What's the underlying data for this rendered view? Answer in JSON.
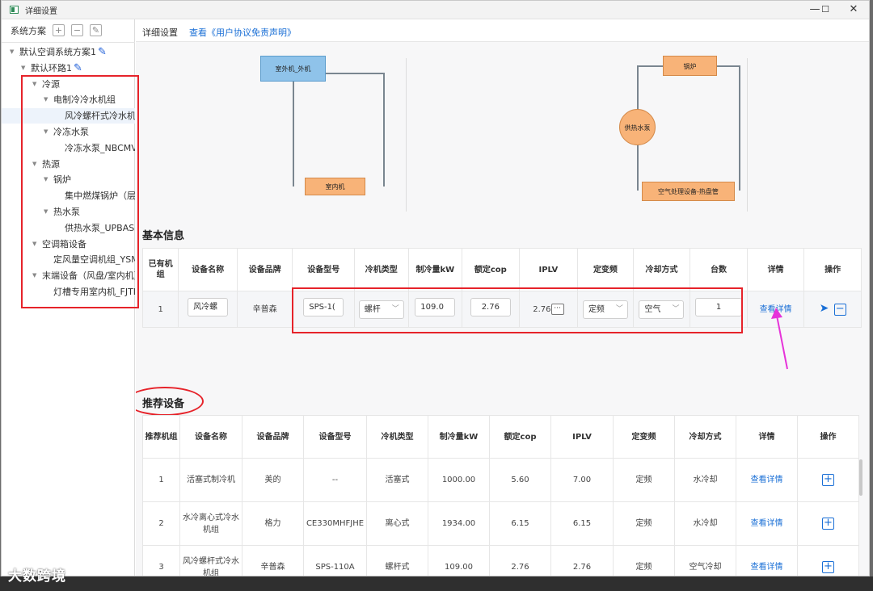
{
  "window": {
    "title": "详细设置",
    "buttons": [
      "—",
      "☐",
      "✕"
    ]
  },
  "sidebar": {
    "header": "系统方案",
    "tools": [
      "+",
      "−",
      "✎"
    ],
    "tree": [
      {
        "label": "默认空调系统方案1",
        "level": 0,
        "caret": true,
        "pencil": true
      },
      {
        "label": "默认环路1",
        "level": 1,
        "caret": true,
        "pencil": true
      },
      {
        "label": "冷源",
        "level": 2,
        "caret": true
      },
      {
        "label": "电制冷冷水机组",
        "level": 3,
        "caret": true
      },
      {
        "label": "风冷螺杆式冷水机组",
        "level": 4,
        "selected": true
      },
      {
        "label": "冷冻水泵",
        "level": 3,
        "caret": true
      },
      {
        "label": "冷冻水泵_NBCMV",
        "level": 4
      },
      {
        "label": "热源",
        "level": 2,
        "caret": true
      },
      {
        "label": "锅炉",
        "level": 3,
        "caret": true
      },
      {
        "label": "集中燃煤锅炉（层",
        "level": 4
      },
      {
        "label": "热水泵",
        "level": 3,
        "caret": true
      },
      {
        "label": "供热水泵_UPBASI",
        "level": 4
      },
      {
        "label": "空调箱设备",
        "level": 2,
        "caret": true
      },
      {
        "label": "定风量空调机组_YSM",
        "level": 3
      },
      {
        "label": "末端设备（风盘/室内机）",
        "level": 2,
        "caret": true
      },
      {
        "label": "灯槽专用室内机_FJTI",
        "level": 3
      }
    ]
  },
  "topbar": {
    "title": "详细设置",
    "link": "查看《用户协议免责声明》"
  },
  "diagram": {
    "outdoor": "室外机_外机",
    "indoor": "室内机",
    "boiler": "锅炉",
    "pump": "供热水泵",
    "ahu": "空气处理设备-热盘管"
  },
  "basic": {
    "title": "基本信息",
    "headers": [
      "已有机组",
      "设备名称",
      "设备品牌",
      "设备型号",
      "冷机类型",
      "制冷量kW",
      "额定cop",
      "IPLV",
      "定变频",
      "冷却方式",
      "台数",
      "详情",
      "操作"
    ],
    "row": {
      "no": "1",
      "name": "风冷螺",
      "brand": "辛普森",
      "model": "SPS-1(",
      "type": "螺杆",
      "capacity": "109.0",
      "cop": "2.76",
      "iplv": "2.76",
      "freq": "定频",
      "cooling": "空气",
      "count": "1",
      "detail": "查看详情"
    }
  },
  "recommend": {
    "title": "推荐设备",
    "headers": [
      "推荐机组",
      "设备名称",
      "设备品牌",
      "设备型号",
      "冷机类型",
      "制冷量kW",
      "额定cop",
      "IPLV",
      "定变频",
      "冷却方式",
      "详情",
      "操作"
    ],
    "rows": [
      {
        "no": "1",
        "name": "活塞式制冷机",
        "brand": "美的",
        "model": "--",
        "type": "活塞式",
        "capacity": "1000.00",
        "cop": "5.60",
        "iplv": "7.00",
        "freq": "定频",
        "cooling": "水冷却",
        "detail": "查看详情"
      },
      {
        "no": "2",
        "name": "水冷离心式冷水机组",
        "brand": "格力",
        "model": "CE330MHFJHE",
        "type": "离心式",
        "capacity": "1934.00",
        "cop": "6.15",
        "iplv": "6.15",
        "freq": "定频",
        "cooling": "水冷却",
        "detail": "查看详情"
      },
      {
        "no": "3",
        "name": "风冷螺杆式冷水机组",
        "brand": "辛普森",
        "model": "SPS-110A",
        "type": "螺杆式",
        "capacity": "109.00",
        "cop": "2.76",
        "iplv": "2.76",
        "freq": "定频",
        "cooling": "空气冷却",
        "detail": "查看详情"
      }
    ]
  },
  "watermark": "大数跨境",
  "colors": {
    "accent": "#1a6fd6",
    "annotation": "#e6232a",
    "arrow": "#e633d9",
    "outdoor_box": "#8fc3ea",
    "orange_box": "#f8b378"
  }
}
